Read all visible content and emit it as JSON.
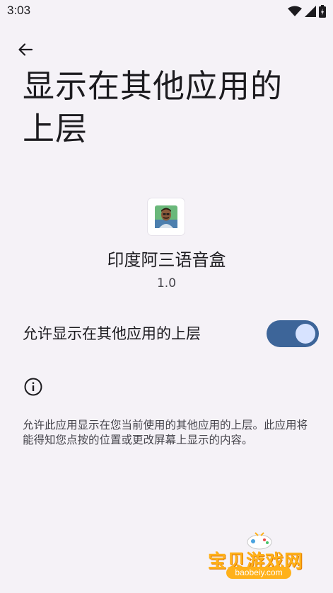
{
  "status_bar": {
    "time": "3:03",
    "icons": [
      "wifi-icon",
      "signal-icon",
      "battery-icon"
    ]
  },
  "header": {
    "back_icon": "arrow-back-icon",
    "title": "显示在其他应用的上层"
  },
  "app": {
    "name": "印度阿三语音盒",
    "version": "1.0"
  },
  "permission": {
    "label": "允许显示在其他应用的上层",
    "enabled": true
  },
  "info": {
    "icon": "info-icon",
    "description": "允许此应用显示在您当前使用的其他应用的上层。此应用将能得知您点按的位置或更改屏幕上显示的内容。"
  },
  "watermark": {
    "text": "宝贝游戏网",
    "url": "baobeiy.com"
  },
  "colors": {
    "background": "#f5f2f7",
    "toggle_track": "#3d6599",
    "toggle_thumb": "#d7e3ff",
    "watermark": "#ffb11a"
  }
}
